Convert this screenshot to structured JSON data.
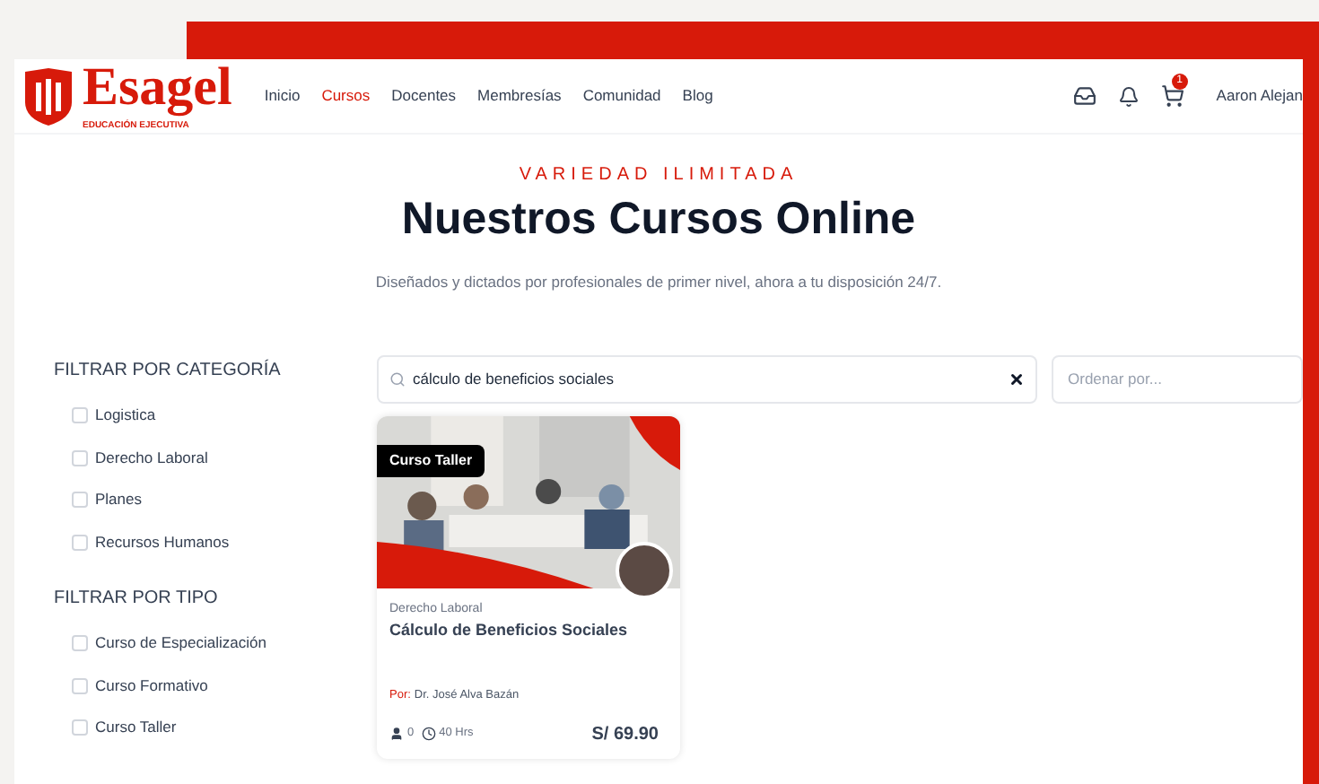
{
  "brand": {
    "name": "Esagel",
    "tagline": "EDUCACIÓN EJECUTIVA"
  },
  "nav": [
    {
      "label": "Inicio",
      "selected": false
    },
    {
      "label": "Cursos",
      "selected": true
    },
    {
      "label": "Docentes",
      "selected": false
    },
    {
      "label": "Membresías",
      "selected": false
    },
    {
      "label": "Comunidad",
      "selected": false
    },
    {
      "label": "Blog",
      "selected": false
    }
  ],
  "cart": {
    "count": "1"
  },
  "user": {
    "name": "Aaron Alejan"
  },
  "hero": {
    "eyebrow": "VARIEDAD ILIMITADA",
    "title": "Nuestros Cursos Online",
    "subtitle": "Diseñados y dictados por profesionales de primer nivel, ahora a tu disposición 24/7."
  },
  "filters": [
    {
      "title": "FILTRAR POR CATEGORÍA",
      "options": [
        {
          "label": "Logistica",
          "checked": false
        },
        {
          "label": "Derecho Laboral",
          "checked": false
        },
        {
          "label": "Planes",
          "checked": false
        },
        {
          "label": "Recursos Humanos",
          "checked": false
        }
      ]
    },
    {
      "title": "FILTRAR POR TIPO",
      "options": [
        {
          "label": "Curso de Especialización",
          "checked": false
        },
        {
          "label": "Curso Formativo",
          "checked": false
        },
        {
          "label": "Curso Taller",
          "checked": false
        }
      ]
    }
  ],
  "search": {
    "value": "cálculo de beneficios sociales"
  },
  "sort": {
    "placeholder": "Ordenar por..."
  },
  "courses": [
    {
      "badge": "Curso Taller",
      "category": "Derecho Laboral",
      "title": "Cálculo de Beneficios Sociales",
      "by_label": "Por:",
      "instructor": "Dr. José Alva Bazán",
      "students": "0",
      "hours": "40 Hrs",
      "price": "S/ 69.90"
    }
  ]
}
